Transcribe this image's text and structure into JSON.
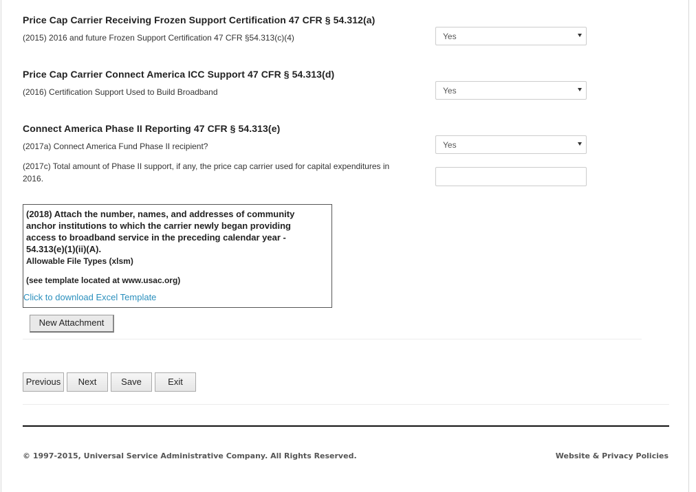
{
  "sections": [
    {
      "title": "Price Cap Carrier Receiving Frozen Support Certification 47 CFR § 54.312(a)",
      "question": "(2015) 2016 and future Frozen Support Certification 47 CFR §54.313(c)(4)",
      "answer": "Yes"
    },
    {
      "title": "Price Cap Carrier Connect America ICC Support 47 CFR § 54.313(d)",
      "question": "(2016) Certification Support Used to Build Broadband",
      "answer": "Yes"
    },
    {
      "title": "Connect America Phase II Reporting 47 CFR § 54.313(e)",
      "question": "(2017a) Connect America Fund Phase II recipient?",
      "answer": "Yes",
      "question2_line1": "(2017c) Total amount of Phase II support, if any, the price cap carrier used for capital expenditures in",
      "question2_line2": "2016.",
      "amount_value": ""
    }
  ],
  "attachment": {
    "title_line1": "(2018) Attach the number, names, and addresses of community",
    "title_line2": "anchor institutions to which the carrier newly began providing",
    "title_line3": "access to broadband service in the preceding calendar year -",
    "title_line4": "54.313(e)(1)(ii)(A).",
    "allowed_types": "Allowable File Types (xlsm)",
    "template_note": "(see template located at www.usac.org)",
    "download_link": "Click to download Excel Template",
    "new_button": "New Attachment"
  },
  "nav": {
    "previous": "Previous",
    "next": "Next",
    "save": "Save",
    "exit": "Exit"
  },
  "footer": {
    "copyright": "© 1997-2015, Universal Service Administrative Company. All Rights Reserved.",
    "privacy": "Website & Privacy Policies"
  }
}
